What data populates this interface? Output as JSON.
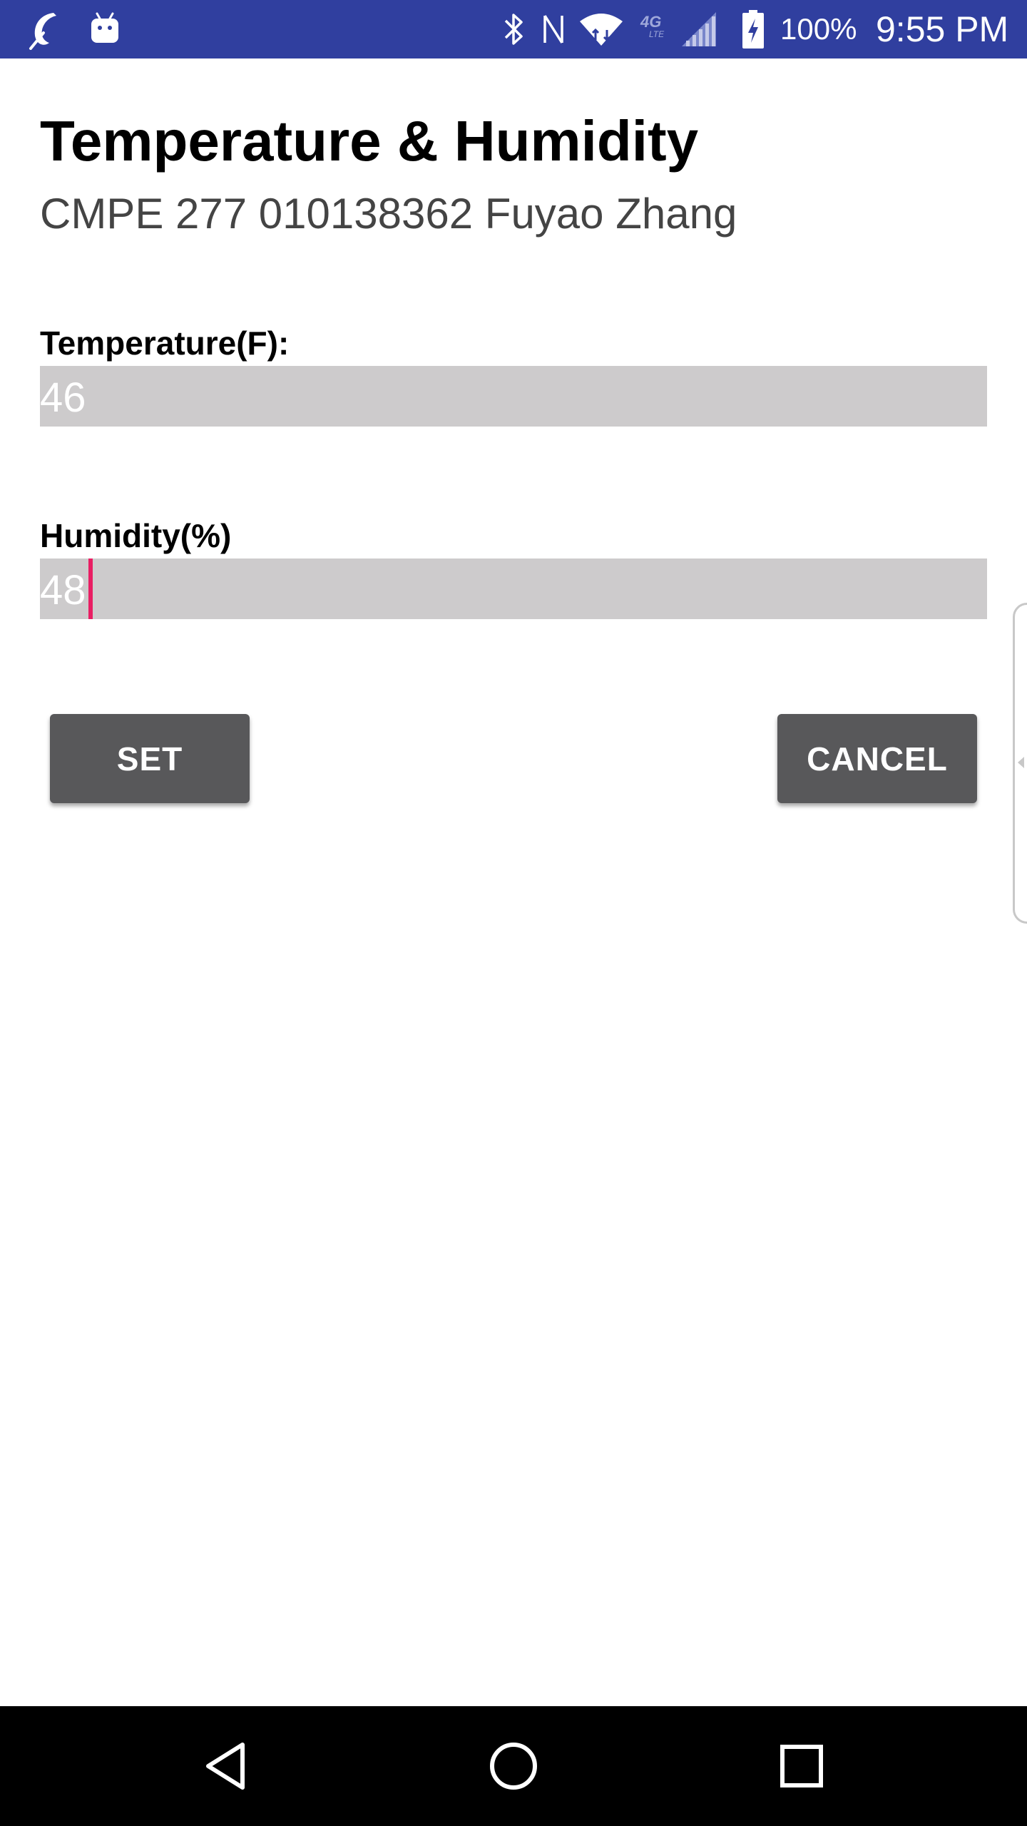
{
  "status_bar": {
    "battery": "100%",
    "time": "9:55 PM",
    "network_type": "4G LTE",
    "left_icons": [
      "app-notification-icon",
      "android-debug-icon"
    ],
    "right_icons": [
      "bluetooth-icon",
      "nfc-icon",
      "wifi-icon",
      "lte-icon",
      "cell-signal-icon",
      "battery-icon"
    ],
    "background_color": "#303f9f"
  },
  "header": {
    "title": "Temperature & Humidity",
    "subtitle": "CMPE 277 010138362 Fuyao Zhang"
  },
  "fields": {
    "temperature": {
      "label": "Temperature(F):",
      "value": "46"
    },
    "humidity": {
      "label": "Humidity(%)",
      "value": "48",
      "focused": true
    }
  },
  "buttons": {
    "set_label": "SET",
    "cancel_label": "CANCEL"
  },
  "nav_bar": {
    "icons": [
      "back-icon",
      "home-icon",
      "recents-icon"
    ]
  },
  "colors": {
    "accent": "#e91e63",
    "field_background": "#cdcbcc",
    "button_background": "#58585a"
  }
}
